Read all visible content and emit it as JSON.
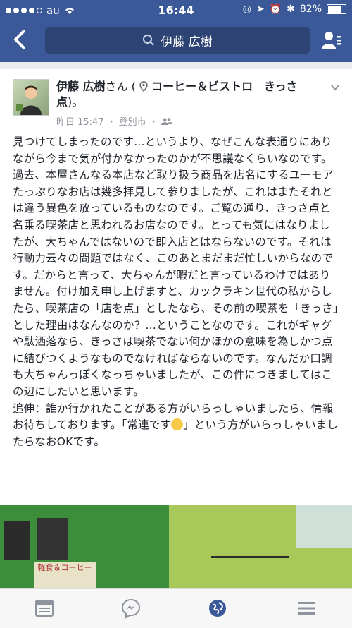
{
  "status_bar": {
    "carrier": "au",
    "time": "16:44",
    "battery": "82%",
    "battery_level": 0.82
  },
  "nav": {
    "search_text": "伊藤 広樹"
  },
  "post": {
    "author": "伊藤 広樹",
    "author_suffix": "さん (",
    "place": "コーヒー＆ビストロ　きっさ点",
    "place_suffix": ")。",
    "timestamp": "昨日 15:47",
    "location": "登別市",
    "separator": "・",
    "body_part1": "見つけてしまったのです…というより、なぜこんな表通りにありながら今まで気が付かなかったのかが不思議なくらいなのです。過去、本屋さんなる本店など取り扱う商品を店名にするユーモアたっぷりなお店は幾多拝見して参りましたが、これはまたそれとは違う異色を放っているものなのです。ご覧の通り、きっさ点と名乗る喫茶店と思われるお店なのです。とっても気にはなりましたが、大ちゃんではないので即入店とはならないのです。それは行動力云々の問題ではなく、このあとまだまだ忙しいからなのです。だからと言って、大ちゃんが暇だと言っているわけではありません。付け加え申し上げますと、カックラキン世代の私からしたら、喫茶店の「店を点」としたなら、その前の喫茶を「きっさ」とした理由はなんなのか？…ということなのです。これがギャグや駄洒落なら、きっさは喫茶でない何かほかの意味を為しかつ点に結びつくようなものでなければならないのです。なんだか口調も大ちゃんっぽくなっちゃいましたが、この件につきましてはこの辺にしたいと思います。\n追伸：誰か行かれたことがある方がいらっしゃいましたら、情報お待ちしております。「常連です",
    "body_part2": "」という方がいらっしゃいましたらなおOKです。",
    "photo_sign": "軽食＆コーヒー"
  },
  "icons": [
    "back-icon",
    "search-icon",
    "friends-icon",
    "location-pin-icon",
    "friends-audience-icon",
    "chevron-down-icon",
    "news-feed-icon",
    "messenger-icon",
    "globe-notifications-icon",
    "menu-icon"
  ]
}
